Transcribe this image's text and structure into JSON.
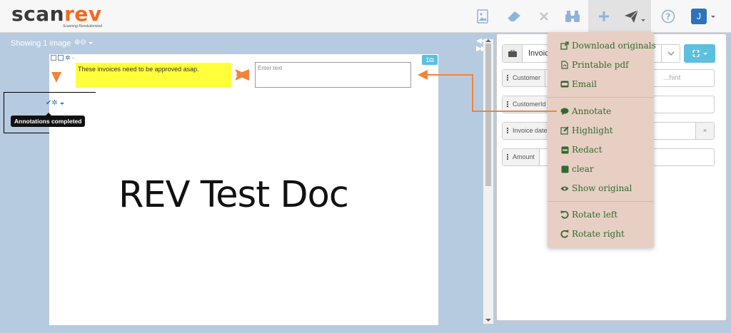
{
  "app": {
    "logo_primary": "scan",
    "logo_accent": "rev",
    "logo_tagline": "Scanning Revolutionized",
    "brand_color": "#f26a21",
    "accent_color": "#2d73b9"
  },
  "toolbar": {
    "icons": [
      "image-icon",
      "eraser-icon",
      "close-icon",
      "binoculars-icon",
      "plus-icon",
      "send-icon",
      "help-icon"
    ],
    "user_initial": "J"
  },
  "viewer": {
    "showing_label": "Showing 1 image",
    "zoom_label": "⊕⊖",
    "page_badge": "1",
    "highlight_text": "These invoices need to be approved asap.",
    "annotation_placeholder": "Enter text",
    "doc_title": "REV Test Doc",
    "tooltip": "Annotations completed"
  },
  "panel": {
    "doc_type": "Invoices",
    "fields": [
      {
        "label": "Customer",
        "value": "...hint"
      },
      {
        "label": "CustomerId",
        "value": ""
      },
      {
        "label": "Invoice date",
        "value": ""
      },
      {
        "label": "Amount",
        "value": ""
      }
    ],
    "clear_symbol": "×"
  },
  "menu": {
    "items": [
      {
        "label": "Download originals",
        "icon": "external-link-icon"
      },
      {
        "label": "Printable pdf",
        "icon": "pdf-icon"
      },
      {
        "label": "Email",
        "icon": "email-icon"
      },
      {
        "label": "Annotate",
        "icon": "comment-icon"
      },
      {
        "label": "Highlight",
        "icon": "edit-icon"
      },
      {
        "label": "Redact",
        "icon": "minus-square-icon"
      },
      {
        "label": "clear",
        "icon": "square-icon"
      },
      {
        "label": "Show original",
        "icon": "eye-icon"
      },
      {
        "label": "Rotate left",
        "icon": "rotate-left-icon"
      },
      {
        "label": "Rotate right",
        "icon": "rotate-right-icon"
      }
    ]
  }
}
